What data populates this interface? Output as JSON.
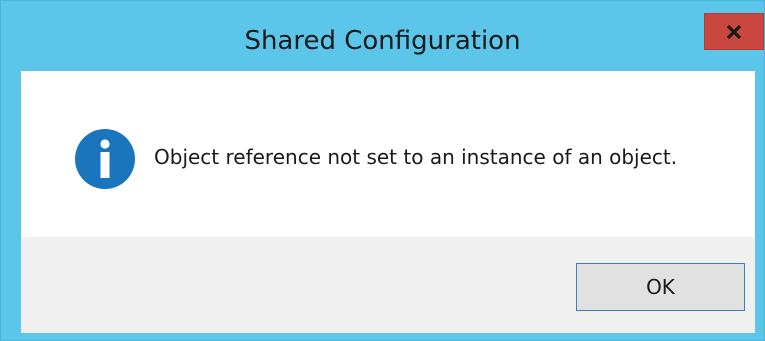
{
  "window": {
    "title": "Shared Configuration",
    "close_label": "x"
  },
  "message": {
    "icon": "information-icon",
    "text": "Object reference not set to an instance of an object."
  },
  "buttons": {
    "ok_label": "OK"
  },
  "colors": {
    "titlebar": "#5bc5ea",
    "close_button": "#c9473f",
    "info_icon": "#1b75bc",
    "footer": "#f0f0f0",
    "ok_border": "#3d7ec4"
  }
}
